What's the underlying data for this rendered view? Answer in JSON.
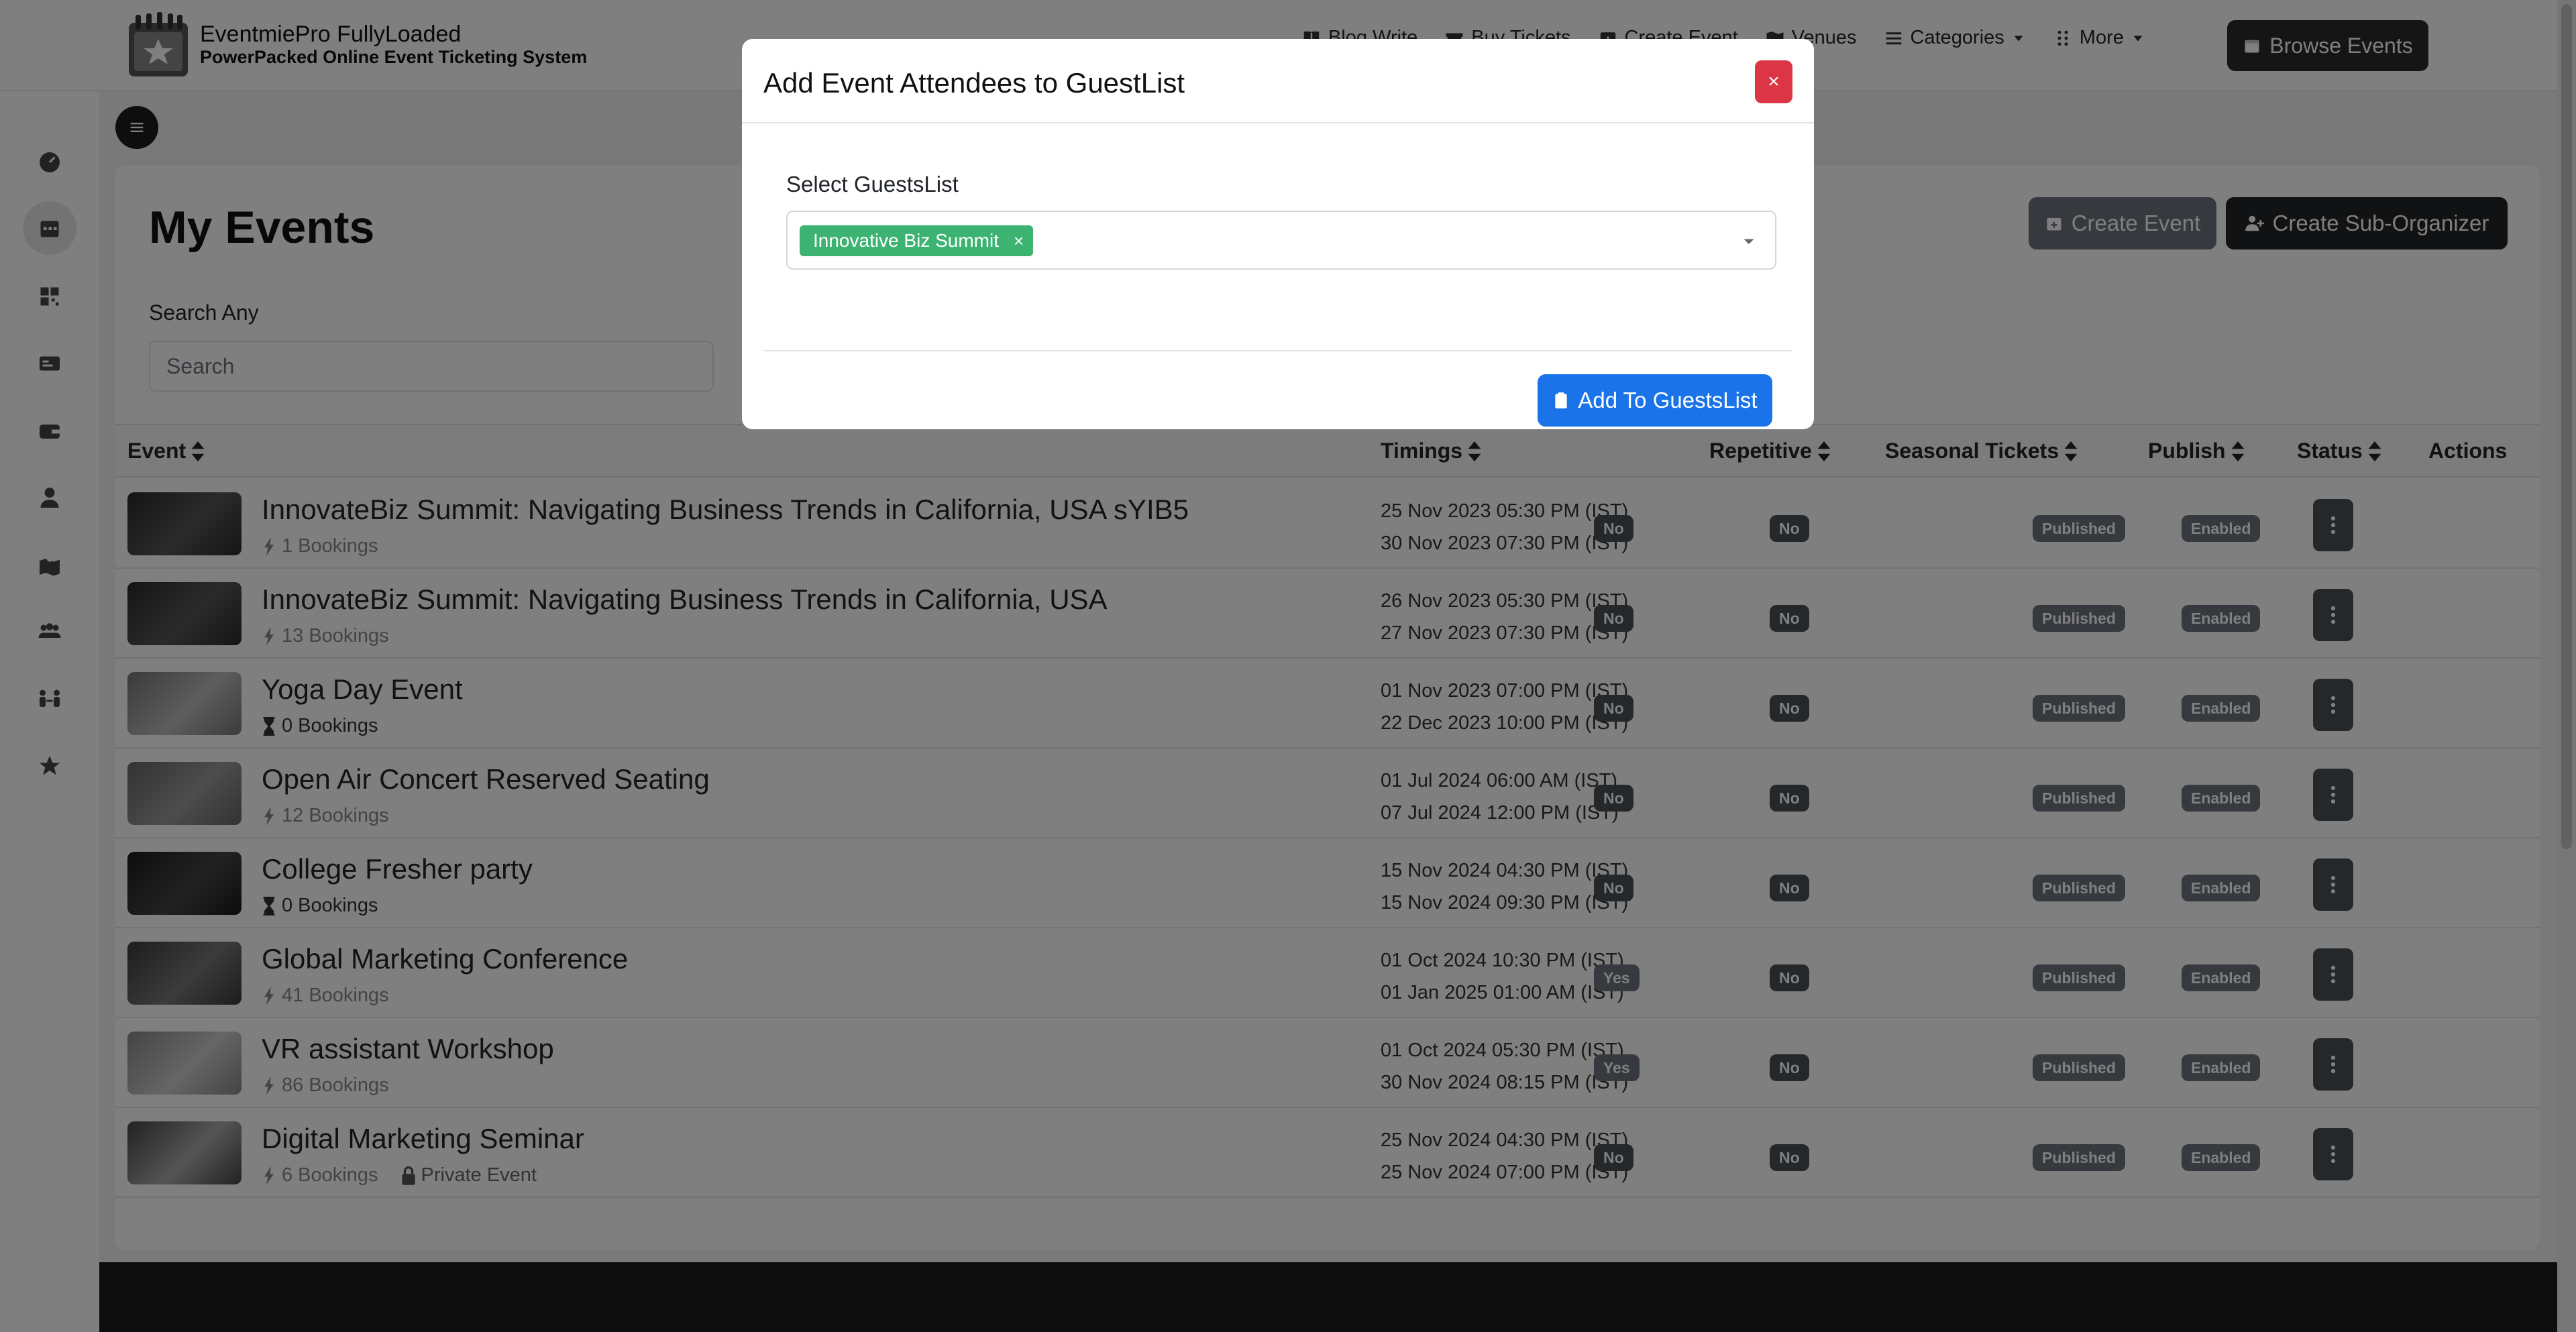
{
  "brand": {
    "title": "EventmiePro FullyLoaded",
    "subtitle": "PowerPacked Online Event Ticketing System"
  },
  "nav": {
    "items": [
      {
        "label": "Blog Write",
        "icon": "book-icon"
      },
      {
        "label": "Buy Tickets",
        "icon": "ticket-icon"
      },
      {
        "label": "Create Event",
        "icon": "calendar-plus-icon"
      },
      {
        "label": "Venues",
        "icon": "map-icon"
      },
      {
        "label": "Categories",
        "icon": "list-icon"
      },
      {
        "label": "More",
        "icon": "grid-icon"
      }
    ],
    "browse_label": "Browse Events"
  },
  "sidebar": {
    "icons": [
      "dashboard-icon",
      "calendar-icon",
      "qrcode-icon",
      "id-card-icon",
      "wallet-icon",
      "user-tie-icon",
      "map-location-icon",
      "users-icon",
      "people-arrows-icon",
      "star-icon"
    ]
  },
  "page": {
    "title": "My Events",
    "create_event_label": "Create Event",
    "create_sub_org_label": "Create Sub-Organizer",
    "search_label": "Search Any",
    "search_placeholder": "Search"
  },
  "table": {
    "headers": [
      "Event",
      "Timings",
      "Repetitive",
      "Seasonal Tickets",
      "Publish",
      "Status",
      "Actions"
    ],
    "rows": [
      {
        "name": "InnovateBiz Summit: Navigating Business Trends in California, USA sYIB5",
        "bookings": "1 Bookings",
        "booking_icon": "bolt-icon",
        "start": "25 Nov 2023 05:30 PM (IST)",
        "end": "30 Nov 2023 07:30 PM (IST)",
        "repetitive": "No",
        "seasonal": "No",
        "publish": "Published",
        "status": "Enabled",
        "private": ""
      },
      {
        "name": "InnovateBiz Summit: Navigating Business Trends in California, USA",
        "bookings": "13 Bookings",
        "booking_icon": "bolt-icon",
        "start": "26 Nov 2023 05:30 PM (IST)",
        "end": "27 Nov 2023 07:30 PM (IST)",
        "repetitive": "No",
        "seasonal": "No",
        "publish": "Published",
        "status": "Enabled",
        "private": ""
      },
      {
        "name": "Yoga Day Event",
        "bookings": "0 Bookings",
        "booking_icon": "hourglass-icon",
        "start": "01 Nov 2023 07:00 PM (IST)",
        "end": "22 Dec 2023 10:00 PM (IST)",
        "repetitive": "No",
        "seasonal": "No",
        "publish": "Published",
        "status": "Enabled",
        "private": ""
      },
      {
        "name": "Open Air Concert Reserved Seating",
        "bookings": "12 Bookings",
        "booking_icon": "bolt-icon",
        "start": "01 Jul 2024 06:00 AM (IST)",
        "end": "07 Jul 2024 12:00 PM (IST)",
        "repetitive": "No",
        "seasonal": "No",
        "publish": "Published",
        "status": "Enabled",
        "private": ""
      },
      {
        "name": "College Fresher party",
        "bookings": "0 Bookings",
        "booking_icon": "hourglass-icon",
        "start": "15 Nov 2024 04:30 PM (IST)",
        "end": "15 Nov 2024 09:30 PM (IST)",
        "repetitive": "No",
        "seasonal": "No",
        "publish": "Published",
        "status": "Enabled",
        "private": ""
      },
      {
        "name": "Global Marketing Conference",
        "bookings": "41 Bookings",
        "booking_icon": "bolt-icon",
        "start": "01 Oct 2024 10:30 PM (IST)",
        "end": "01 Jan 2025 01:00 AM (IST)",
        "repetitive": "Yes",
        "seasonal": "No",
        "publish": "Published",
        "status": "Enabled",
        "private": ""
      },
      {
        "name": "VR assistant Workshop",
        "bookings": "86 Bookings",
        "booking_icon": "bolt-icon",
        "start": "01 Oct 2024 05:30 PM (IST)",
        "end": "30 Nov 2024 08:15 PM (IST)",
        "repetitive": "Yes",
        "seasonal": "No",
        "publish": "Published",
        "status": "Enabled",
        "private": ""
      },
      {
        "name": "Digital Marketing Seminar",
        "bookings": "6 Bookings",
        "booking_icon": "bolt-icon",
        "start": "25 Nov 2024 04:30 PM (IST)",
        "end": "25 Nov 2024 07:00 PM (IST)",
        "repetitive": "No",
        "seasonal": "No",
        "publish": "Published",
        "status": "Enabled",
        "private": "Private Event"
      }
    ]
  },
  "modal": {
    "title": "Add Event Attendees to GuestList",
    "close_label": "×",
    "field_label": "Select GuestsList",
    "selected_tag": "Innovative Biz Summit",
    "tag_remove": "×",
    "submit_label": "Add To GuestsList"
  },
  "colors": {
    "tag": "#3cb371",
    "primary": "#1a73e8",
    "danger": "#dc3545",
    "dark": "#212529"
  }
}
